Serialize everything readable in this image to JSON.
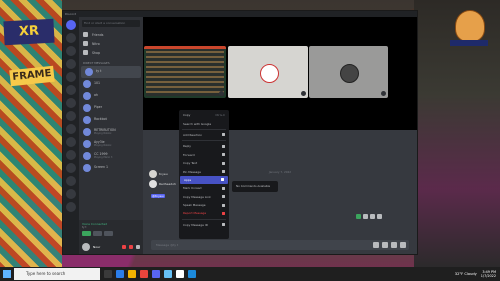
{
  "window": {
    "app_title": "Discord"
  },
  "search": {
    "placeholder": "Find or start a conversation"
  },
  "nav": [
    {
      "label": "Friends",
      "icon": "friends-icon"
    },
    {
      "label": "Nitro",
      "icon": "nitro-icon"
    },
    {
      "label": "Shop",
      "icon": "shop-icon"
    }
  ],
  "dm_header": "DIRECT MESSAGES",
  "dms": [
    {
      "name": "ty t",
      "sub": ""
    },
    {
      "name": "101",
      "sub": ""
    },
    {
      "name": "ah",
      "sub": ""
    },
    {
      "name": "Piper",
      "sub": ""
    },
    {
      "name": "Rockbot",
      "sub": ""
    },
    {
      "name": "RETRIBUTION",
      "sub": "Playing Roblox"
    },
    {
      "name": "Ayy3ie",
      "sub": "Playing Roblox"
    },
    {
      "name": "CC 1999",
      "sub": "Playing Mario 3"
    },
    {
      "name": "Screen 1",
      "sub": ""
    }
  ],
  "voice": {
    "status": "Voice Connected",
    "channel": "ty t"
  },
  "user": {
    "name": "Nour",
    "tag": "#4321"
  },
  "chat": {
    "date_divider": "January 7, 2022",
    "message_author": "tnyeu",
    "mention": "@tnyeu",
    "mention_author": "Redheadoh",
    "input_placeholder": "Message @ty t"
  },
  "context_menu": {
    "items": [
      {
        "label": "Copy",
        "shortcut": "Ctrl+C"
      },
      {
        "label": "Search with Google",
        "shortcut": ""
      },
      {
        "label": "Add Reaction",
        "shortcut": ""
      },
      {
        "label": "Reply",
        "shortcut": ""
      },
      {
        "label": "Forward",
        "shortcut": ""
      },
      {
        "label": "Copy Text",
        "shortcut": ""
      },
      {
        "label": "Pin Message",
        "shortcut": ""
      },
      {
        "label": "Apps",
        "shortcut": ""
      },
      {
        "label": "Mark Unread",
        "shortcut": ""
      },
      {
        "label": "Copy Message Link",
        "shortcut": ""
      },
      {
        "label": "Speak Message",
        "shortcut": ""
      },
      {
        "label": "Report Message",
        "shortcut": ""
      },
      {
        "label": "Copy Message ID",
        "shortcut": ""
      }
    ],
    "selected": "Apps",
    "submenu_text": "No Commands Available"
  },
  "taskbar": {
    "search_placeholder": "Type here to search",
    "weather": "32°F Cloudy",
    "time": "3:49 PM",
    "date": "1/7/2022"
  },
  "colors": {
    "accent": "#5865f2",
    "selected": "#4752c4",
    "danger": "#ed4245",
    "online": "#3ba55d"
  }
}
